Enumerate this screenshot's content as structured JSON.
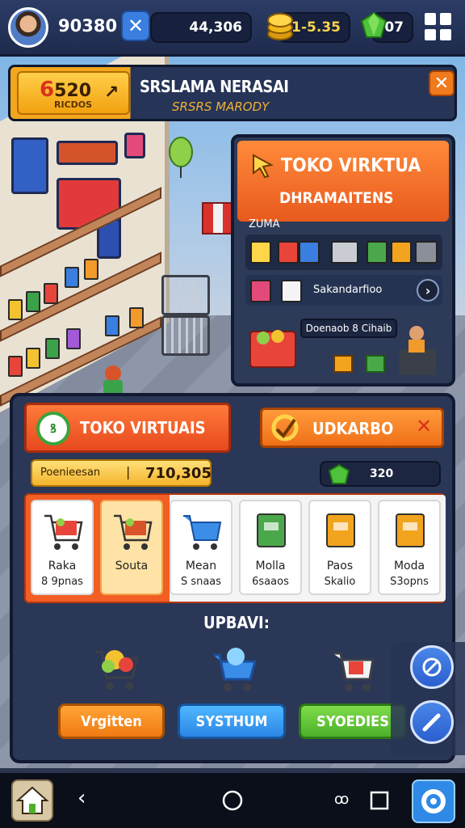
{
  "topbar": {
    "player_score": "90380",
    "x_badge": "✕",
    "stat_value": "44,306",
    "coins": "1-5.35",
    "gems": "07"
  },
  "quest": {
    "reward_prefix": "6",
    "reward_value": "520",
    "reward_sub": "RICDOS",
    "title": "SRSLAMA NERASAI",
    "subtitle": "SRSRS MARODY",
    "close": "✕"
  },
  "store_panel": {
    "title": "TOKO VIRKTUA",
    "subtitle": "DHRAMAITENS",
    "label": "ZUMA",
    "row2_label": "Sakandarfioo",
    "row2_next": "›",
    "row3_label": "Doenaob 8 Cihaib"
  },
  "main_panel": {
    "store_badge": "ꝸ",
    "store_name": "TOKO VIRTUAIS",
    "upgrade_tab": "UDKARBO",
    "upgrade_close": "✕",
    "income_label": "Poenieesan",
    "income_sep": "|",
    "income_value": "710,305",
    "gem_value": "320",
    "cards": [
      {
        "name": "Raka",
        "sub": "8 9pnas",
        "icon": "cart-icon",
        "color": "#e8453a"
      },
      {
        "name": "Souta",
        "sub": "",
        "icon": "cart-icon",
        "color": "#d9532a"
      },
      {
        "name": "Mean",
        "sub": "S snaas",
        "icon": "basket-icon",
        "color": "#3a8ee8"
      },
      {
        "name": "Molla",
        "sub": "6saaos",
        "icon": "box-icon",
        "color": "#4aa84a"
      },
      {
        "name": "Paos",
        "sub": "Skalio",
        "icon": "box-icon",
        "color": "#f2a41e"
      },
      {
        "name": "Moda",
        "sub": "S3opns",
        "icon": "box-icon",
        "color": "#f2a41e"
      }
    ],
    "upgrade_heading": "UPBAVI:",
    "upgrade_buttons": [
      "Vrgitten",
      "SYSTHUM",
      "SYOEDIES"
    ]
  },
  "colors": {
    "accent_orange": "#f25e24",
    "accent_blue": "#2b86e6",
    "accent_green": "#4cb12a",
    "panel": "#2b3756"
  }
}
